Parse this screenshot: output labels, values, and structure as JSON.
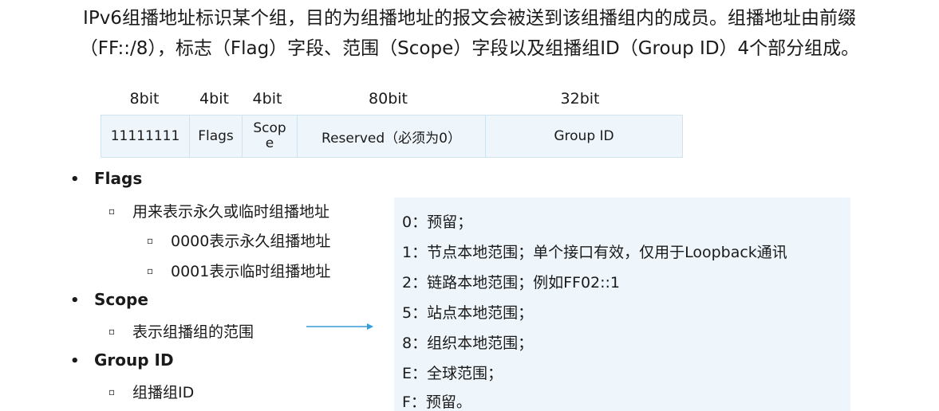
{
  "intro": {
    "line1": "IPv6组播地址标识某个组，目的为组播地址的报文会被送到该组播组内的成员。组播地址由前缀",
    "line2": "（FF::/8），标志（Flag）字段、范围（Scope）字段以及组播组ID（Group ID）4个部分组成。"
  },
  "format": {
    "bits": [
      "8bit",
      "4bit",
      "4bit",
      "80bit",
      "32bit"
    ],
    "fields": {
      "prefix": "11111111",
      "flags": "Flags",
      "scope_line1": "Scop",
      "scope_line2": "e",
      "reserved": "Reserved（必须为0）",
      "group_id": "Group ID"
    }
  },
  "bullets": {
    "flags": {
      "title": "Flags",
      "desc": "用来表示永久或临时组播地址",
      "sub1": "0000表示永久组播地址",
      "sub2": "0001表示临时组播地址"
    },
    "scope": {
      "title": "Scope",
      "desc": "表示组播组的范围"
    },
    "group_id": {
      "title": "Group ID",
      "desc": "组播组ID"
    },
    "bullet_glyph": "•",
    "sub_glyph": "▫"
  },
  "scope_values": [
    "0：预留；",
    "1：节点本地范围；单个接口有效，仅用于Loopback通讯",
    "2：链路本地范围；例如FF02::1",
    "5：站点本地范围；",
    "8：组织本地范围；",
    "E：全球范围；",
    "F：预留。"
  ],
  "colors": {
    "table_bg": "#eef5fb",
    "table_border": "#cfe3ef",
    "arrow": "#3a9bd5",
    "box_bg": "#eef5fb"
  }
}
